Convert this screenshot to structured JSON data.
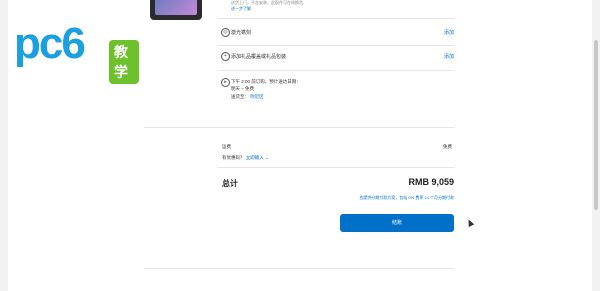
{
  "logo": {
    "text": "pc6",
    "badge": "教学"
  },
  "product": {
    "note": "送货上门，不含安装，此配件可在线换货",
    "more_link": "进一步了解"
  },
  "options": [
    {
      "icon": "laser-engrave-icon",
      "label": "激光镌刻",
      "action": "添加"
    },
    {
      "icon": "gift-icon",
      "label": "添加礼品覆盖或礼品包装",
      "action": "添加"
    }
  ],
  "delivery": {
    "line1": "下午 2:00 前订购，预计送达日期：",
    "line2": "明天 – 免费",
    "location_label": "送货至：",
    "location_value": "附近区"
  },
  "summary": {
    "shipping_label": "运费",
    "shipping_value": "免费",
    "promo_prompt": "有优惠码？",
    "promo_link": "立即输入 ⌄",
    "total_label": "总计",
    "total_value": "RMB 9,059",
    "installment_text": "也提供分期付款方案，包括 0% 费率 24 个月分期付款"
  },
  "checkout": {
    "label": "结账"
  }
}
